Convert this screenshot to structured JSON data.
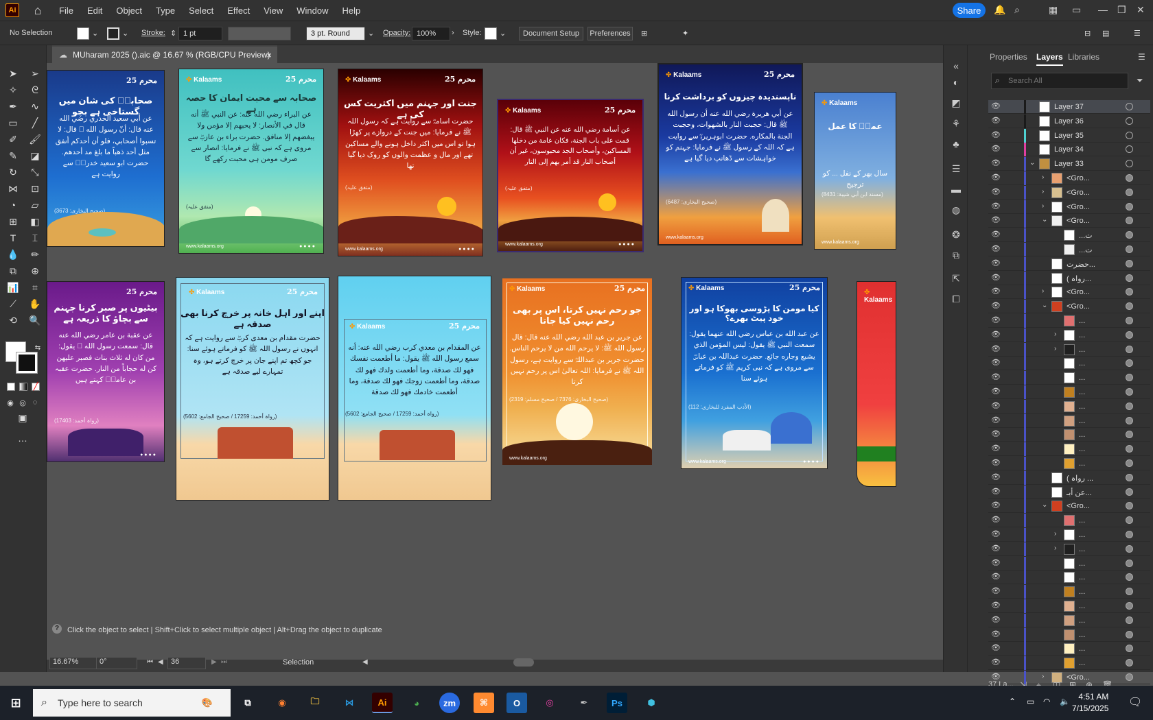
{
  "app": {
    "logo_text": "Ai",
    "menus": [
      "File",
      "Edit",
      "Object",
      "Type",
      "Select",
      "Effect",
      "View",
      "Window",
      "Help"
    ],
    "share_label": "Share"
  },
  "control": {
    "selection": "No Selection",
    "stroke_label": "Stroke:",
    "stroke_value": "1 pt",
    "brush": "3 pt. Round",
    "opacity_label": "Opacity:",
    "opacity_value": "100%",
    "style_label": "Style:",
    "document_setup": "Document Setup",
    "preferences": "Preferences"
  },
  "document": {
    "tab_title": "MUharam 2025 ().aic @ 16.67 % (RGB/CPU Preview)",
    "close": "×"
  },
  "artboards": {
    "brand": "Kalaams",
    "badge": "محرم 25",
    "footer_url": "www.kalaams.org",
    "a1": {
      "title": "صحابہؓ کی شان میں گستاخی ہے بچو",
      "body": "عن أبي سعيد الخدري رضي الله عنه قال: أنّ رسول الله ﷺ قال: لا تسبوا أصحابي، فلو أن أحدكم أنفق مثل أحد ذهباً ما بلغ مد أحدهم. حضرت ابو سعید خدریؓ سے روایت ہے",
      "ref": "(صحیح البخاری: 3673)"
    },
    "a2": {
      "title": "صحابہ سے محبت ایمان کا حصہ ہے",
      "body": "عن البراء رضي الله عنه: عن النبي ﷺ أنه قال في الأنصار: لا يحبهم إلا مؤمن ولا يبغضهم إلا منافق. حضرت براء بن عازبؓ سے مروی ہے کہ نبی ﷺ نے فرمایا: انصار سے صرف مومن ہی محبت رکھے گا",
      "ref": "(متفق علیہ)"
    },
    "a3": {
      "title": "جنت اور جہنم میں اکثریت کس کی ہے",
      "body": "حضرت اسامہؓ سے روایت ہے کہ رسول اللہ ﷺ نے فرمایا: میں جنت کے دروازے پر کھڑا ہوا تو اس میں اکثر داخل ہونے والے مساکین تھے اور مال و عظمت والوں کو روک دیا گیا تھا",
      "ref": "(متفق علیہ)"
    },
    "a4": {
      "title": "",
      "body": "عن أسامة رضي الله عنه عن النبي ﷺ قال: قمت على باب الجنة، فكان عامة من دخلها المساكين، وأصحاب الجد محبوسون، غير أن أصحاب النار قد أمر بهم إلى النار",
      "ref": "(متفق علیہ)"
    },
    "a5": {
      "title": "ناپسندیدہ چیزوں کو برداشت کرنا",
      "body": "عن أبي هريرة رضي الله عنه أن رسول الله ﷺ قال: حجبت النار بالشهوات، وحجبت الجنة بالمكاره. حضرت ابوہریرہؓ سے روایت ہے کہ اللہ کے رسول ﷺ نے فرمایا: جہنم کو خواہشات سے ڈھانپ دیا گیا ہے",
      "ref": "(صحیح البخاری: 6487)"
    },
    "a6": {
      "title": "عمرؓ کا عمل",
      "body": "سال بھر کے نفل ... کو ترجیح",
      "ref": "(مسند ابن أبي شيبة: 8431)"
    },
    "a7": {
      "title": "بیٹیوں پر صبر کرنا جہنم سے بچاؤ کا ذریعہ ہے",
      "body": "عن عقبة بن عامر رضي الله عنه قال: سمعت رسول الله ﷺ يقول: من كان له ثلاث بنات فصبر عليهن كن له حجاباً من النار. حضرت عقبہ بن عامرؓ کہتے ہیں",
      "ref": "(رواہ أحمد: 17403)"
    },
    "a8": {
      "title": "اپنے اور اہل خانہ پر خرچ کرنا بھی صدقہ ہے",
      "body": "حضرت مقدام بن معدی کربؓ سے روایت ہے کہ انہوں نے رسول اللہ ﷺ کو فرماتے ہوئے سنا: جو کچھ تم اپنے جان پر خرچ کرتے ہو، وہ تمہارے لیے صدقہ ہے",
      "ref": "(رواہ أحمد: 17259 / صحیح الجامع: 5602)"
    },
    "a9": {
      "title": "",
      "body": "عن المقدام بن معدي كرب رضي الله عنه: أنه سمع رسول الله ﷺ يقول: ما أطعمت نفسك فهو لك صدقة، وما أطعمت ولدك فهو لك صدقة، وما أطعمت زوجك فهو لك صدقة، وما أطعمت خادمك فهو لك صدقة",
      "ref": "(رواہ أحمد: 17259 / صحیح الجامع: 5602)"
    },
    "a10": {
      "title": "جو رحم نہیں کرتا، اس پر بھی رحم نہیں کیا جاتا",
      "body": "عن جرير بن عبد الله رضي الله عنه قال: قال رسول الله ﷺ: لا يرحم الله من لا يرحم الناس. حضرت جریر بن عبداللہؓ سے روایت ہے، رسول اللہ ﷺ نے فرمایا: اللہ تعالیٰ اس پر رحم نہیں کرتا",
      "ref": "(صحیح البخاری: 7376 / صحیح مسلم: 2319)"
    },
    "a11": {
      "title": "کیا مومن کا پڑوسی بھوکا ہو اور خود پیٹ بھرے؟",
      "body": "عن عبد الله بن عباس رضي الله عنهما يقول: سمعت النبي ﷺ يقول: ليس المؤمن الذي يشبع وجاره جائع. حضرت عبداللہ بن عباسؓ سے مروی ہے کہ نبی کریم ﷺ کو فرماتے ہوئے سنا",
      "ref": "(الأدب المفرد للبخاري: 112)"
    },
    "a12": {
      "title": "",
      "body": "",
      "ref": ""
    }
  },
  "panel": {
    "tabs": [
      "Properties",
      "Layers",
      "Libraries"
    ],
    "search_placeholder": "Search All",
    "layers_count": "37 La...",
    "rows": [
      {
        "name": "Layer 37",
        "color": "#1a1a1a",
        "indent": 0,
        "arrow": "",
        "sel": true,
        "thumb": "#ffffff"
      },
      {
        "name": "Layer 36",
        "color": "#1a1a1a",
        "indent": 0,
        "arrow": "",
        "sel": false,
        "thumb": "#ffffff"
      },
      {
        "name": "Layer 35",
        "color": "#4fd1d1",
        "indent": 0,
        "arrow": "",
        "sel": false,
        "thumb": "#ffffff"
      },
      {
        "name": "Layer 34",
        "color": "#e03fa0",
        "indent": 0,
        "arrow": "",
        "sel": false,
        "thumb": "#ffffff"
      },
      {
        "name": "Layer 33",
        "color": "#4a52c8",
        "indent": 0,
        "arrow": "v",
        "sel": false,
        "thumb": "#c09040"
      },
      {
        "name": "<Gro...",
        "color": "#4a52c8",
        "indent": 1,
        "arrow": ">",
        "sel": false,
        "thumb": "#e8a070"
      },
      {
        "name": "<Gro...",
        "color": "#4a52c8",
        "indent": 1,
        "arrow": ">",
        "sel": false,
        "thumb": "#d8c090"
      },
      {
        "name": "<Gro...",
        "color": "#4a52c8",
        "indent": 1,
        "arrow": ">",
        "sel": false,
        "thumb": "#ffffff"
      },
      {
        "name": "<Gro...",
        "color": "#4a52c8",
        "indent": 1,
        "arrow": "v",
        "sel": false,
        "thumb": "#f0f0f0"
      },
      {
        "name": "...ت",
        "color": "#4a52c8",
        "indent": 2,
        "arrow": "",
        "sel": false,
        "thumb": "#ffffff"
      },
      {
        "name": "...ت",
        "color": "#4a52c8",
        "indent": 2,
        "arrow": "",
        "sel": false,
        "thumb": "#f0f0f0"
      },
      {
        "name": "حضرت...",
        "color": "#4a52c8",
        "indent": 1,
        "arrow": "",
        "sel": false,
        "thumb": "#ffffff"
      },
      {
        "name": "( رواہ...",
        "color": "#4a52c8",
        "indent": 1,
        "arrow": "",
        "sel": false,
        "thumb": "#ffffff"
      },
      {
        "name": "<Gro...",
        "color": "#4a52c8",
        "indent": 1,
        "arrow": ">",
        "sel": false,
        "thumb": "#ffffff"
      },
      {
        "name": "<Gro...",
        "color": "#4a52c8",
        "indent": 1,
        "arrow": "v",
        "sel": false,
        "thumb": "#d04020"
      },
      {
        "name": "...",
        "color": "#4a52c8",
        "indent": 2,
        "arrow": "",
        "sel": false,
        "thumb": "#e07070"
      },
      {
        "name": "...",
        "color": "#4a52c8",
        "indent": 2,
        "arrow": ">",
        "sel": false,
        "thumb": "#ffffff"
      },
      {
        "name": "...",
        "color": "#4a52c8",
        "indent": 2,
        "arrow": ">",
        "sel": false,
        "thumb": "#202020"
      },
      {
        "name": "...",
        "color": "#4a52c8",
        "indent": 2,
        "arrow": "",
        "sel": false,
        "thumb": "#ffffff"
      },
      {
        "name": "...",
        "color": "#4a52c8",
        "indent": 2,
        "arrow": "",
        "sel": false,
        "thumb": "#ffffff"
      },
      {
        "name": "...",
        "color": "#4a52c8",
        "indent": 2,
        "arrow": "",
        "sel": false,
        "thumb": "#c08020"
      },
      {
        "name": "...",
        "color": "#4a52c8",
        "indent": 2,
        "arrow": "",
        "sel": false,
        "thumb": "#e0b090"
      },
      {
        "name": "...",
        "color": "#4a52c8",
        "indent": 2,
        "arrow": "",
        "sel": false,
        "thumb": "#d0a080"
      },
      {
        "name": "...",
        "color": "#4a52c8",
        "indent": 2,
        "arrow": "",
        "sel": false,
        "thumb": "#c09070"
      },
      {
        "name": "...",
        "color": "#4a52c8",
        "indent": 2,
        "arrow": "",
        "sel": false,
        "thumb": "#fff0c0"
      },
      {
        "name": "...",
        "color": "#4a52c8",
        "indent": 2,
        "arrow": "",
        "sel": false,
        "thumb": "#e0a030"
      },
      {
        "name": "( رواہ ...",
        "color": "#4a52c8",
        "indent": 1,
        "arrow": "",
        "sel": false,
        "thumb": "#ffffff"
      },
      {
        "name": "عن أبـ...",
        "color": "#4a52c8",
        "indent": 1,
        "arrow": "",
        "sel": false,
        "thumb": "#ffffff"
      },
      {
        "name": "<Gro...",
        "color": "#4a52c8",
        "indent": 1,
        "arrow": "v",
        "sel": false,
        "thumb": "#d04020"
      },
      {
        "name": "...",
        "color": "#4a52c8",
        "indent": 2,
        "arrow": "",
        "sel": false,
        "thumb": "#e07070"
      },
      {
        "name": "...",
        "color": "#4a52c8",
        "indent": 2,
        "arrow": ">",
        "sel": false,
        "thumb": "#ffffff"
      },
      {
        "name": "...",
        "color": "#4a52c8",
        "indent": 2,
        "arrow": ">",
        "sel": false,
        "thumb": "#202020"
      },
      {
        "name": "...",
        "color": "#4a52c8",
        "indent": 2,
        "arrow": "",
        "sel": false,
        "thumb": "#ffffff"
      },
      {
        "name": "...",
        "color": "#4a52c8",
        "indent": 2,
        "arrow": "",
        "sel": false,
        "thumb": "#ffffff"
      },
      {
        "name": "...",
        "color": "#4a52c8",
        "indent": 2,
        "arrow": "",
        "sel": false,
        "thumb": "#c08020"
      },
      {
        "name": "...",
        "color": "#4a52c8",
        "indent": 2,
        "arrow": "",
        "sel": false,
        "thumb": "#e0b090"
      },
      {
        "name": "...",
        "color": "#4a52c8",
        "indent": 2,
        "arrow": "",
        "sel": false,
        "thumb": "#d0a080"
      },
      {
        "name": "...",
        "color": "#4a52c8",
        "indent": 2,
        "arrow": "",
        "sel": false,
        "thumb": "#c09070"
      },
      {
        "name": "...",
        "color": "#4a52c8",
        "indent": 2,
        "arrow": "",
        "sel": false,
        "thumb": "#fff0c0"
      },
      {
        "name": "...",
        "color": "#4a52c8",
        "indent": 2,
        "arrow": "",
        "sel": false,
        "thumb": "#e0a030"
      },
      {
        "name": "<Gro...",
        "color": "#4a52c8",
        "indent": 1,
        "arrow": ">",
        "sel": false,
        "thumb": "#d0b080"
      },
      {
        "name": "<Gro...",
        "color": "#4a52c8",
        "indent": 1,
        "arrow": ">",
        "sel": false,
        "thumb": "#b0a060"
      }
    ]
  },
  "status": {
    "hint": "Click the object to select  |  Shift+Click to select multiple object  |  Alt+Drag the object to duplicate",
    "zoom": "16.67%",
    "rotation": "0°",
    "artboard": "36",
    "tool": "Selection"
  },
  "taskbar": {
    "search_placeholder": "Type here to search",
    "time": "4:51 AM",
    "date": "7/15/2025"
  }
}
